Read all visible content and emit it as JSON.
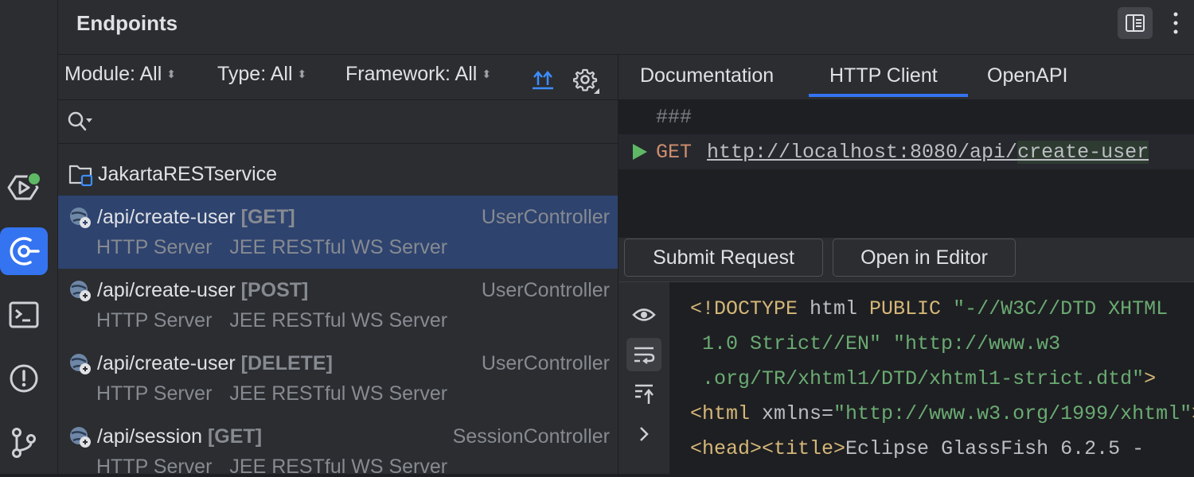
{
  "header": {
    "title": "Endpoints"
  },
  "activity_bar": {
    "items": [
      {
        "name": "services",
        "icon": "services-icon",
        "has_notification": true
      },
      {
        "name": "endpoints",
        "icon": "endpoints-icon",
        "active": true
      },
      {
        "name": "terminal",
        "icon": "terminal-icon"
      },
      {
        "name": "problems",
        "icon": "problems-icon"
      },
      {
        "name": "git",
        "icon": "git-branch-icon"
      }
    ]
  },
  "filters": {
    "module": "Module: All",
    "type": "Type: All",
    "framework": "Framework: All",
    "arrows": "⬍"
  },
  "search": {
    "placeholder": ""
  },
  "tree": {
    "root_label": "JakartaRESTservice",
    "endpoints": [
      {
        "path": "/api/create-user",
        "method": "[GET]",
        "controller": "UserController",
        "server": "HTTP Server",
        "framework": "JEE RESTful WS Server",
        "selected": true
      },
      {
        "path": "/api/create-user",
        "method": "[POST]",
        "controller": "UserController",
        "server": "HTTP Server",
        "framework": "JEE RESTful WS Server"
      },
      {
        "path": "/api/create-user",
        "method": "[DELETE]",
        "controller": "UserController",
        "server": "HTTP Server",
        "framework": "JEE RESTful WS Server"
      },
      {
        "path": "/api/session",
        "method": "[GET]",
        "controller": "SessionController",
        "server": "HTTP Server",
        "framework": "JEE RESTful WS Server"
      }
    ]
  },
  "right": {
    "tabs": [
      {
        "label": "Documentation"
      },
      {
        "label": "HTTP Client",
        "active": true
      },
      {
        "label": "OpenAPI"
      }
    ],
    "request": {
      "hash": "###",
      "method": "GET",
      "url_base": "http://localhost:8080/api/",
      "url_highlight": "create-user"
    },
    "buttons": {
      "submit": "Submit Request",
      "open": "Open in Editor"
    },
    "response_lines": [
      [
        {
          "c": "t-tag",
          "t": "<!DOCTYPE"
        },
        {
          "c": "t-text",
          "t": " html "
        },
        {
          "c": "t-kw",
          "t": "PUBLIC"
        },
        {
          "c": "t-str",
          "t": " \"-//W3C//DTD XHTML"
        }
      ],
      [
        {
          "c": "t-str",
          "t": " 1.0 Strict//EN\" \"http://www.w3"
        }
      ],
      [
        {
          "c": "t-str",
          "t": " .org/TR/xhtml1/DTD/xhtml1-strict.dtd\""
        },
        {
          "c": "t-tag",
          "t": ">"
        }
      ],
      [
        {
          "c": "t-tag",
          "t": "<html"
        },
        {
          "c": "t-text",
          "t": " xmlns="
        },
        {
          "c": "t-str",
          "t": "\"http://www.w3.org/1999/xhtml\""
        },
        {
          "c": "t-tag",
          "t": ">"
        }
      ],
      [
        {
          "c": "t-tag",
          "t": "<head><title>"
        },
        {
          "c": "t-text",
          "t": "Eclipse GlassFish 6.2.5 - "
        }
      ]
    ]
  },
  "colors": {
    "accent": "#3574f0",
    "selection": "#2e436e",
    "get_method": "#cf8e6d"
  }
}
